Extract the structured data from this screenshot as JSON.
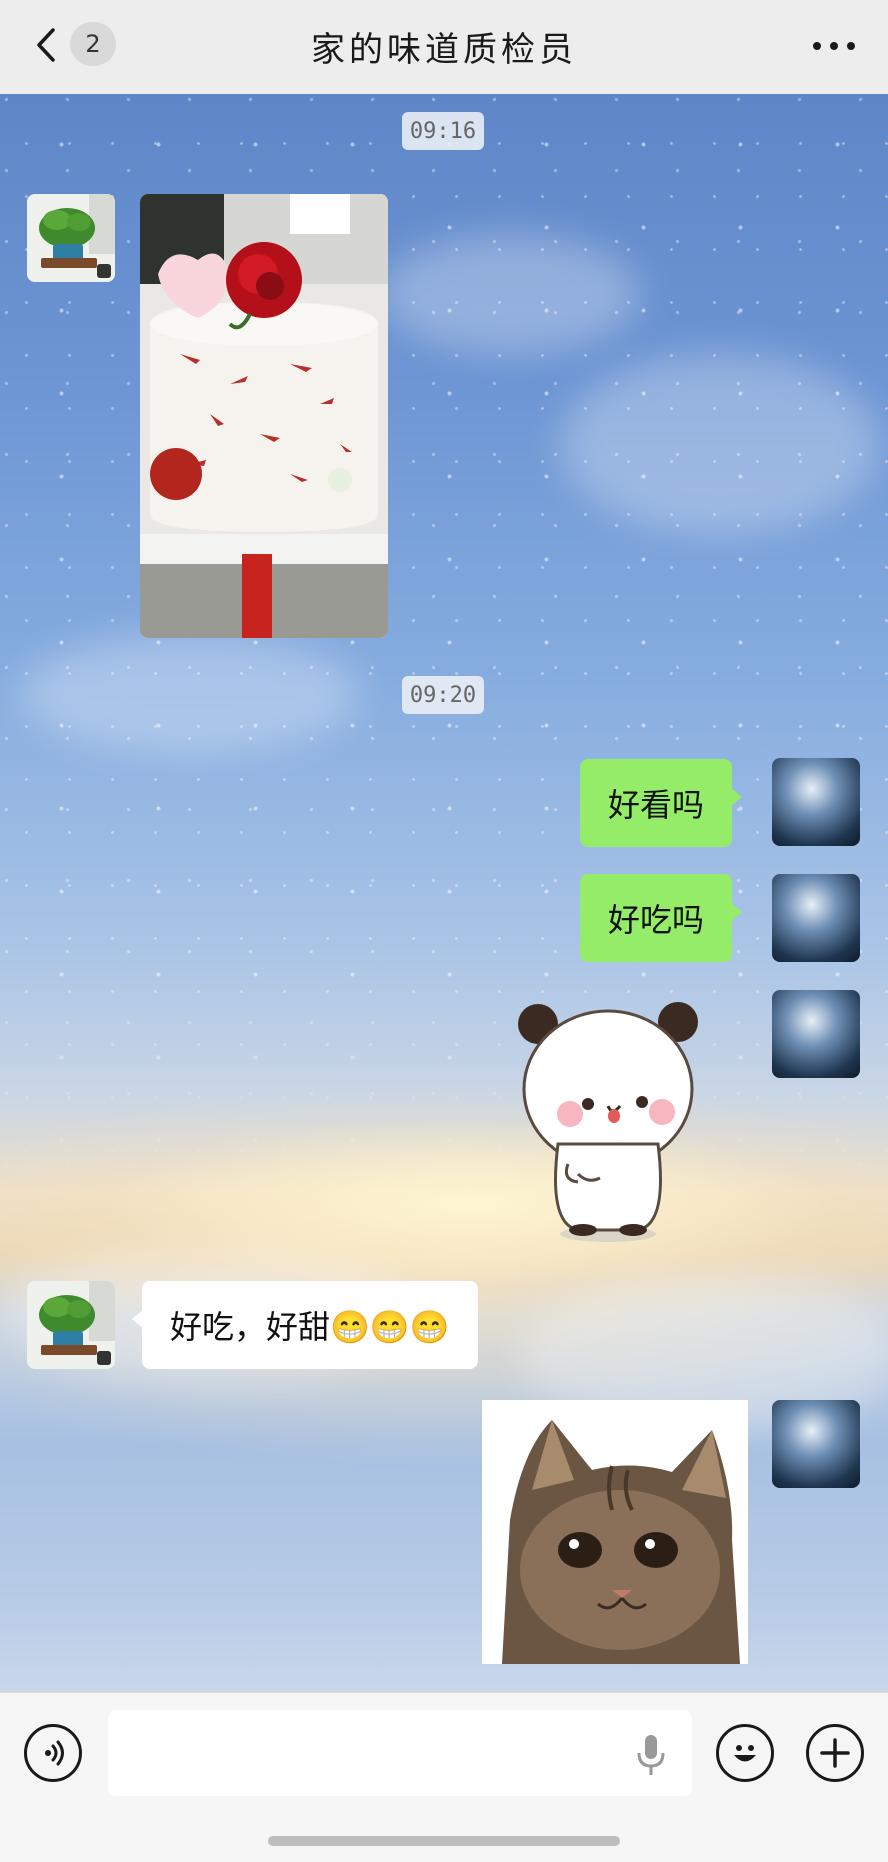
{
  "header": {
    "title": "家的味道质检员",
    "unread_count": "2"
  },
  "messages": {
    "time1": "09:16",
    "time2": "09:20",
    "msg_haokan": "好看吗",
    "msg_haochi": "好吃吗",
    "msg_reply": "好吃，好甜😁😁😁"
  },
  "colors": {
    "header_bg": "#ededed",
    "sent_bubble": "#95ec69",
    "received_bubble": "#ffffff",
    "input_bar_bg": "#f6f6f6"
  },
  "icons": {
    "back": "chevron-left-icon",
    "more": "more-dots-icon",
    "voice": "voice-icon",
    "mic": "microphone-icon",
    "emoji": "emoji-icon",
    "plus": "plus-icon"
  }
}
